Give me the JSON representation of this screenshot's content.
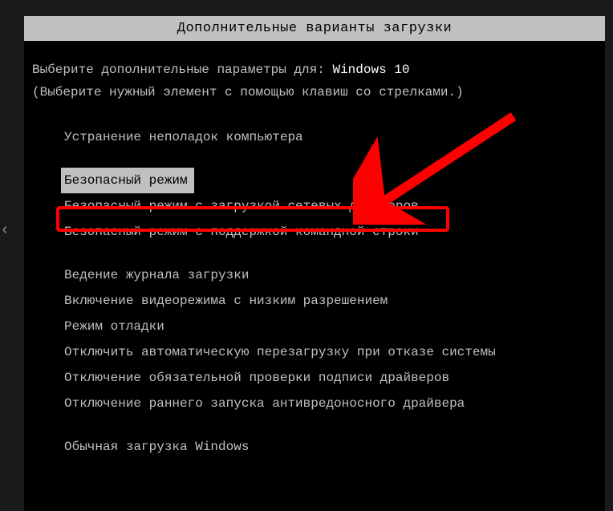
{
  "title": "Дополнительные варианты загрузки",
  "header": {
    "prefix": "Выберите дополнительные параметры для: ",
    "os_name": "Windows 10"
  },
  "hint": "(Выберите нужный элемент с помощью клавиш со стрелками.)",
  "options_group1": [
    "Устранение неполадок компьютера"
  ],
  "options_group2": [
    "Безопасный режим",
    "Безопасный режим с загрузкой сетевых драйверов",
    "Безопасный режим с поддержкой командной строки"
  ],
  "options_group3": [
    "Ведение журнала загрузки",
    "Включение видеорежима с низким разрешением",
    "Режим отладки",
    "Отключить автоматическую перезагрузку при отказе системы",
    "Отключение обязательной проверки подписи драйверов",
    "Отключение раннего запуска антивредоносного драйвера"
  ],
  "options_group4": [
    "Обычная загрузка Windows"
  ],
  "selected_index": {
    "group": 2,
    "idx": 0
  },
  "highlighted_index": {
    "group": 2,
    "idx": 1
  }
}
